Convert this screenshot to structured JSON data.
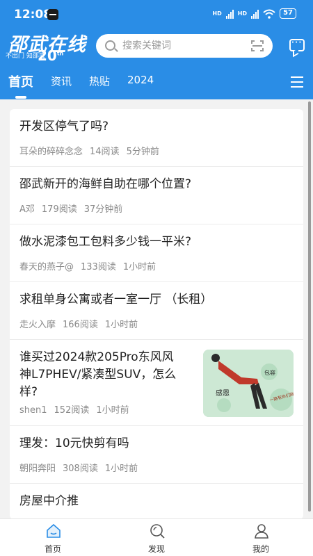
{
  "status_bar": {
    "time": "12:08",
    "network_1": "HD",
    "network_2": "HD",
    "battery": "57"
  },
  "logo": {
    "main": "邵武在线",
    "subtitle": "不出门  知邵武",
    "anniversary": "20",
    "anniversary_suffix": "th",
    "year_label": "YEAR"
  },
  "search": {
    "placeholder": "搜索关键词"
  },
  "tabs": [
    {
      "label": "首页",
      "active": true
    },
    {
      "label": "资讯",
      "active": false
    },
    {
      "label": "热贴",
      "active": false
    },
    {
      "label": "2024",
      "active": false
    }
  ],
  "posts": [
    {
      "title": "开发区停气了吗?",
      "author": "耳朵的碎碎念念",
      "reads": "14阅读",
      "time": "5分钟前"
    },
    {
      "title": "邵武新开的海鲜自助在哪个位置?",
      "author": "A邓",
      "reads": "179阅读",
      "time": "37分钟前"
    },
    {
      "title": "做水泥漆包工包料多少钱一平米?",
      "author": "春天的燕子@",
      "reads": "133阅读",
      "time": "1小时前"
    },
    {
      "title": "求租单身公寓或者一室一厅 （长租）",
      "author": "走火入摩",
      "reads": "166阅读",
      "time": "1小时前"
    },
    {
      "title_line1": "谁买过2024款205Pro东风风",
      "title_line2": "神L7PHEV/紧凑型SUV，怎么",
      "title_line3": "样?",
      "author": "shen1",
      "reads": "152阅读",
      "time": "1小时前",
      "thumb_text_1": "感恩",
      "thumb_text_2": "包容",
      "thumb_text_3": "一路有你们陪伴"
    },
    {
      "title": "理发：10元快剪有吗",
      "author": "朝阳奔阳",
      "reads": "308阅读",
      "time": "1小时前"
    },
    {
      "title": "房屋中介推"
    }
  ],
  "bottom_nav": [
    {
      "label": "首页",
      "icon": "home-icon",
      "active": true
    },
    {
      "label": "发现",
      "icon": "discover-icon",
      "active": false
    },
    {
      "label": "我的",
      "icon": "profile-icon",
      "active": false
    }
  ],
  "colors": {
    "brand": "#2a8de6",
    "text": "#222222",
    "meta": "#888888"
  }
}
